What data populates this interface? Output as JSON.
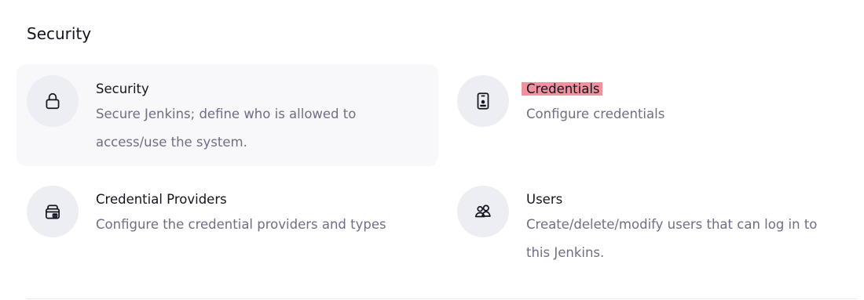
{
  "section": {
    "title": "Security"
  },
  "items": [
    {
      "title": "Security",
      "description": "Secure Jenkins; define who is allowed to access/use the system.",
      "icon": "lock-icon"
    },
    {
      "title": "Credentials",
      "description": "Configure credentials",
      "icon": "id-card-icon",
      "highlight_color": "#f0919f"
    },
    {
      "title": "Credential Providers",
      "description": "Configure the credential providers and types",
      "icon": "credential-store-icon"
    },
    {
      "title": "Users",
      "description": "Create/delete/modify users that can log in to this Jenkins.",
      "icon": "users-icon"
    }
  ],
  "colors": {
    "icon_bg": "#edeef4",
    "hover_bg": "#f8f8fb",
    "description_text": "#6f6e85",
    "highlight": "#f0919f"
  }
}
